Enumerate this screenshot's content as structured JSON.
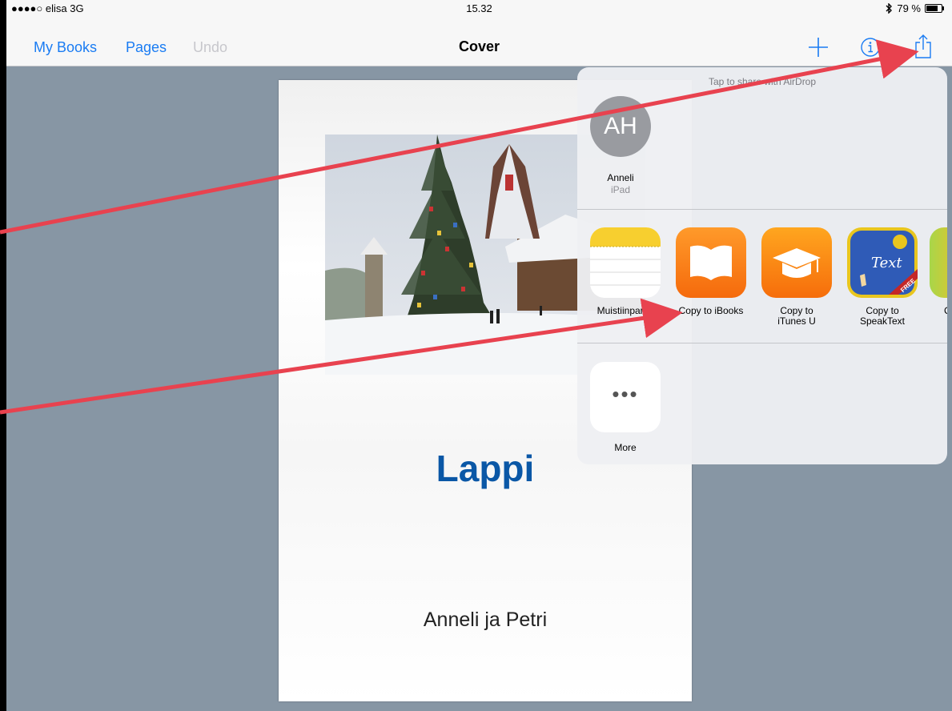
{
  "status_bar": {
    "carrier": "●●●●○ elisa  3G",
    "time": "15.32",
    "battery": "79 %",
    "battery_level": 0.79
  },
  "nav": {
    "my_books": "My Books",
    "pages": "Pages",
    "undo": "Undo",
    "title": "Cover"
  },
  "book": {
    "title": "Lappi",
    "author": "Anneli ja Petri"
  },
  "share_sheet": {
    "airdrop_hint": "Tap to share with AirDrop",
    "airdrop_contact": {
      "initials": "AH",
      "name": "Anneli",
      "device": "iPad"
    },
    "apps": [
      {
        "label": "Muistiinpanot",
        "icon": "notes-icon"
      },
      {
        "label": "Copy to iBooks",
        "icon": "ibooks-icon"
      },
      {
        "label": "Copy to\niTunes U",
        "icon": "itunes-u-icon"
      },
      {
        "label": "Copy to\nSpeakText",
        "icon": "speaktext-icon",
        "icon_text": "Text",
        "badge": "FREE"
      },
      {
        "label": "C",
        "icon": "partial-app-icon"
      }
    ],
    "more_label": "More"
  },
  "colors": {
    "accent": "#1a7cf3",
    "title_blue": "#0a57a6",
    "arrow": "#e8424f"
  }
}
